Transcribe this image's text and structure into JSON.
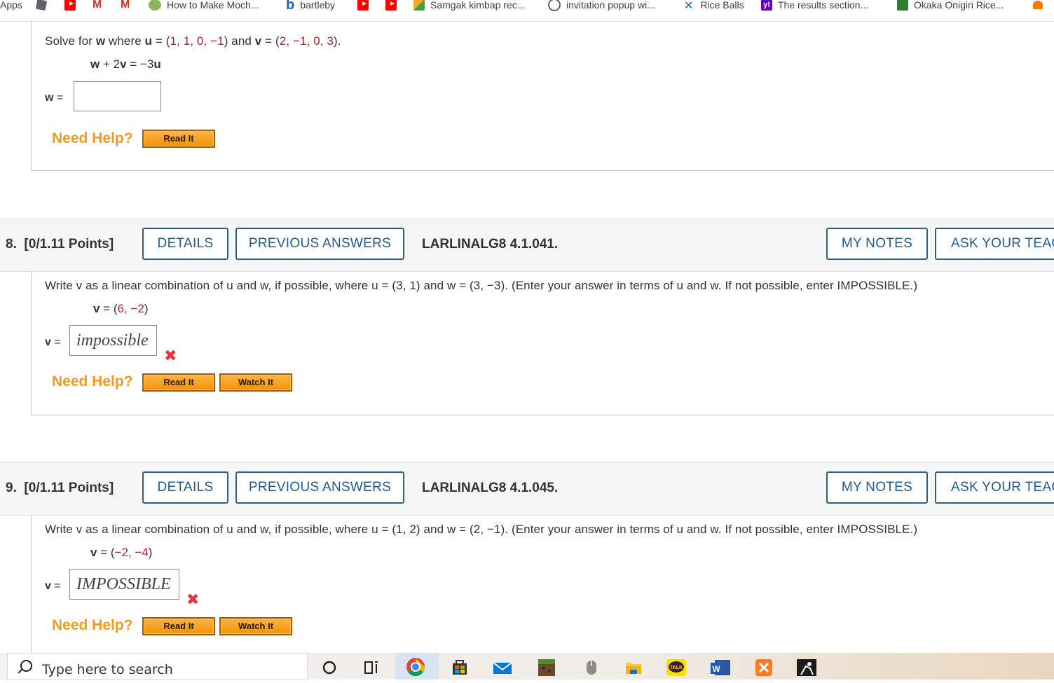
{
  "bookmarks": {
    "apps_label": "Apps",
    "items": [
      {
        "label": "How to Make Moch...",
        "icon": "wikihow-icon"
      },
      {
        "label": "bartleby",
        "icon": "bartleby-icon"
      },
      {
        "label": "Samgak kimbap rec...",
        "icon": "pencil-icon"
      },
      {
        "label": "invitation popup wi...",
        "icon": "globe-icon"
      },
      {
        "label": "Rice Balls",
        "icon": "utensils-icon"
      },
      {
        "label": "The results section...",
        "icon": "yahoo-icon"
      },
      {
        "label": "Okaka Onigiri Rice...",
        "icon": "onigiri-icon"
      }
    ]
  },
  "q7": {
    "text_pre": "Solve for ",
    "var_w": "w",
    "text_where": " where ",
    "var_u": "u",
    "eq1": " = (",
    "u_vals": "1, 1, 0, −1",
    "close1": ")",
    "and": " and ",
    "var_v": "v",
    "eq2": " = (",
    "v_vals": "2, −1, 0, 3",
    "close2": ").",
    "equation_w": "w",
    "equation_mid": " + 2",
    "equation_v": "v",
    "equation_eq": " = −3",
    "equation_u": "u",
    "answer_label_var": "w",
    "answer_label_eq": " =",
    "answer_value": "",
    "need_help": "Need Help?",
    "read_it": "Read It"
  },
  "q8": {
    "number": "8.",
    "points": "[0/1.11 Points]",
    "details": "DETAILS",
    "previous_answers": "PREVIOUS ANSWERS",
    "reference": "LARLINALG8 4.1.041.",
    "my_notes": "MY NOTES",
    "ask_teacher": "ASK YOUR TEAC",
    "text": "Write v as a linear combination of u and w, if possible, where u = (3, 1) and  w = (3, −3).  (Enter your answer in terms of u and w. If not possible, enter IMPOSSIBLE.)",
    "given_var": "v",
    "given_eq": " = (",
    "given_vals": "6, −2",
    "given_close": ")",
    "answer_label_var": "v",
    "answer_label_eq": " =",
    "answer_value": "impossible",
    "need_help": "Need Help?",
    "read_it": "Read It",
    "watch_it": "Watch It"
  },
  "q9": {
    "number": "9.",
    "points": "[0/1.11 Points]",
    "details": "DETAILS",
    "previous_answers": "PREVIOUS ANSWERS",
    "reference": "LARLINALG8 4.1.045.",
    "my_notes": "MY NOTES",
    "ask_teacher": "ASK YOUR TEAC",
    "text": "Write v as a linear combination of u and w, if possible, where u = (1, 2) and w = (2, −1). (Enter your answer in terms of u and w. If not possible, enter IMPOSSIBLE.)",
    "given_var": "v",
    "given_eq": " = (",
    "given_vals": "−2, −4",
    "given_close": ")",
    "answer_label_var": "v",
    "answer_label_eq": " =",
    "answer_value": "IMPOSSIBLE",
    "need_help": "Need Help?",
    "read_it": "Read It",
    "watch_it": "Watch It"
  },
  "taskbar": {
    "search_placeholder": "Type here to search",
    "talk_label": "TALK",
    "word_label": "W"
  },
  "colors": {
    "accent_blue": "#235a87",
    "help_orange": "#f39a1e",
    "error_red": "#e8343a",
    "value_red": "#b02020"
  }
}
